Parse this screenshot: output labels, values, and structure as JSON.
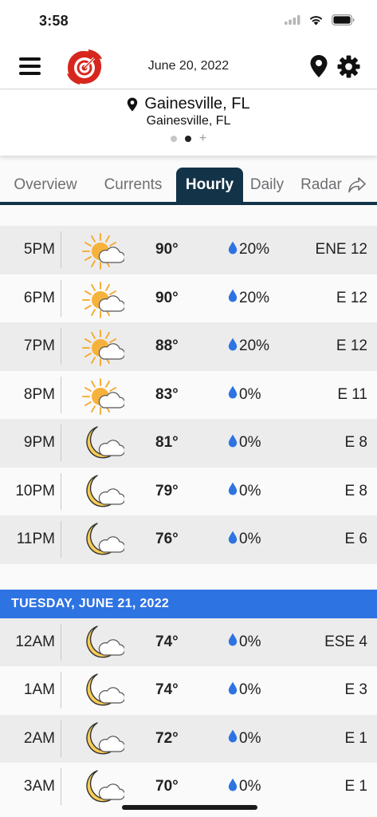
{
  "status_bar": {
    "time": "3:58"
  },
  "header": {
    "date": "June 20, 2022"
  },
  "location": {
    "name": "Gainesville, FL",
    "subtitle": "Gainesville, FL"
  },
  "tabs": [
    {
      "label": "Overview",
      "active": false
    },
    {
      "label": "Currents",
      "active": false
    },
    {
      "label": "Hourly",
      "active": true
    },
    {
      "label": "Daily",
      "active": false
    },
    {
      "label": "Radar",
      "active": false
    }
  ],
  "colors": {
    "accent_dark": "#133348",
    "day_header": "#2e73e2",
    "raindrop": "#2e73e2"
  },
  "today_hours": [
    {
      "time": "5PM",
      "icon": "sun-cloud-icon",
      "temp": "90°",
      "precip": "20%",
      "wind": "ENE 12"
    },
    {
      "time": "6PM",
      "icon": "sun-cloud-icon",
      "temp": "90°",
      "precip": "20%",
      "wind": "E 12"
    },
    {
      "time": "7PM",
      "icon": "sun-cloud-icon",
      "temp": "88°",
      "precip": "20%",
      "wind": "E 12"
    },
    {
      "time": "8PM",
      "icon": "sun-cloud-icon",
      "temp": "83°",
      "precip": "0%",
      "wind": "E 11"
    },
    {
      "time": "9PM",
      "icon": "moon-cloud-icon",
      "temp": "81°",
      "precip": "0%",
      "wind": "E 8"
    },
    {
      "time": "10PM",
      "icon": "moon-cloud-icon",
      "temp": "79°",
      "precip": "0%",
      "wind": "E 8"
    },
    {
      "time": "11PM",
      "icon": "moon-cloud-icon",
      "temp": "76°",
      "precip": "0%",
      "wind": "E 6"
    }
  ],
  "next_day": {
    "header": "TUESDAY, JUNE 21, 2022",
    "hours": [
      {
        "time": "12AM",
        "icon": "moon-cloud-icon",
        "temp": "74°",
        "precip": "0%",
        "wind": "ESE 4"
      },
      {
        "time": "1AM",
        "icon": "moon-cloud-icon",
        "temp": "74°",
        "precip": "0%",
        "wind": "E 3"
      },
      {
        "time": "2AM",
        "icon": "moon-cloud-icon",
        "temp": "72°",
        "precip": "0%",
        "wind": "E 1"
      },
      {
        "time": "3AM",
        "icon": "moon-cloud-icon",
        "temp": "70°",
        "precip": "0%",
        "wind": "E 1"
      }
    ]
  }
}
